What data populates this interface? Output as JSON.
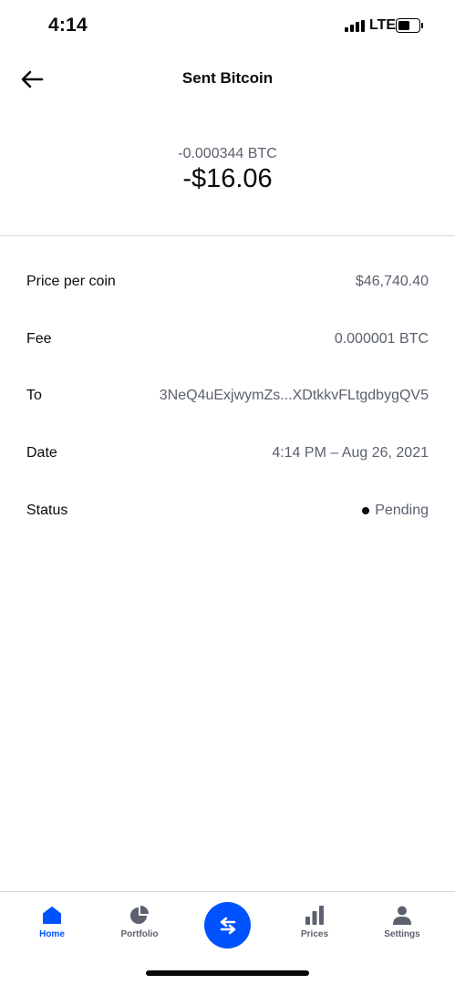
{
  "status_bar": {
    "time": "4:14",
    "network": "LTE"
  },
  "header": {
    "title": "Sent Bitcoin"
  },
  "amount": {
    "crypto": "-0.000344 BTC",
    "fiat": "-$16.06"
  },
  "details": [
    {
      "label": "Price per coin",
      "value": "$46,740.40"
    },
    {
      "label": "Fee",
      "value": "0.000001 BTC"
    },
    {
      "label": "To",
      "value": "3NeQ4uExjwymZs...XDtkkvFLtgdbygQV5"
    },
    {
      "label": "Date",
      "value": "4:14 PM – Aug 26, 2021"
    },
    {
      "label": "Status",
      "value": "Pending"
    }
  ],
  "tabs": [
    {
      "label": "Home",
      "icon": "home-icon",
      "active": true
    },
    {
      "label": "Portfolio",
      "icon": "pie-chart-icon",
      "active": false
    },
    {
      "label": "Prices",
      "icon": "bar-chart-icon",
      "active": false
    },
    {
      "label": "Settings",
      "icon": "person-icon",
      "active": false
    }
  ],
  "trade_button": {
    "icon": "swap-arrows-icon"
  },
  "colors": {
    "accent": "#0052ff",
    "text_primary": "#0a0b0d",
    "text_secondary": "#5b616e",
    "divider": "#d6d9de"
  }
}
